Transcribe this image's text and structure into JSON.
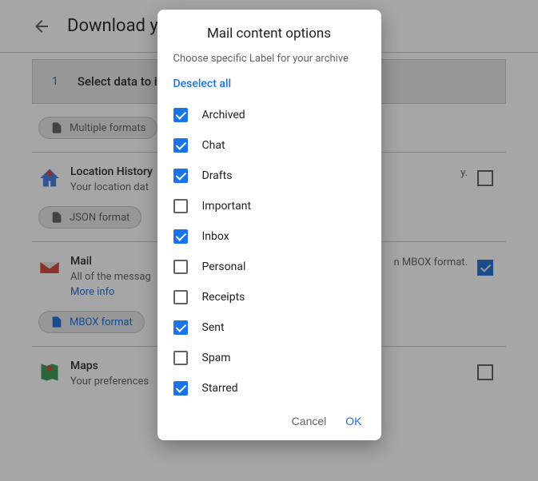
{
  "header": {
    "title": "Download your"
  },
  "step": {
    "number": "1",
    "label": "Select data to in"
  },
  "chips": {
    "multiple": "Multiple formats",
    "json": "JSON format",
    "mbox": "MBOX format"
  },
  "products": {
    "location": {
      "name": "Location History",
      "desc": "Your location dat",
      "desc_tail": "y."
    },
    "mail": {
      "name": "Mail",
      "desc": "All of the messag",
      "desc_tail": "n MBOX format.",
      "more": "More info"
    },
    "maps": {
      "name": "Maps",
      "desc": "Your preferences"
    }
  },
  "dialog": {
    "title": "Mail content options",
    "subtitle": "Choose specific Label for your archive",
    "deselect": "Deselect all",
    "labels": [
      {
        "text": "Archived",
        "checked": true
      },
      {
        "text": "Chat",
        "checked": true
      },
      {
        "text": "Drafts",
        "checked": true
      },
      {
        "text": "Important",
        "checked": false
      },
      {
        "text": "Inbox",
        "checked": true
      },
      {
        "text": "Personal",
        "checked": false
      },
      {
        "text": "Receipts",
        "checked": false
      },
      {
        "text": "Sent",
        "checked": true
      },
      {
        "text": "Spam",
        "checked": false
      },
      {
        "text": "Starred",
        "checked": true
      }
    ],
    "cancel": "Cancel",
    "ok": "OK"
  }
}
